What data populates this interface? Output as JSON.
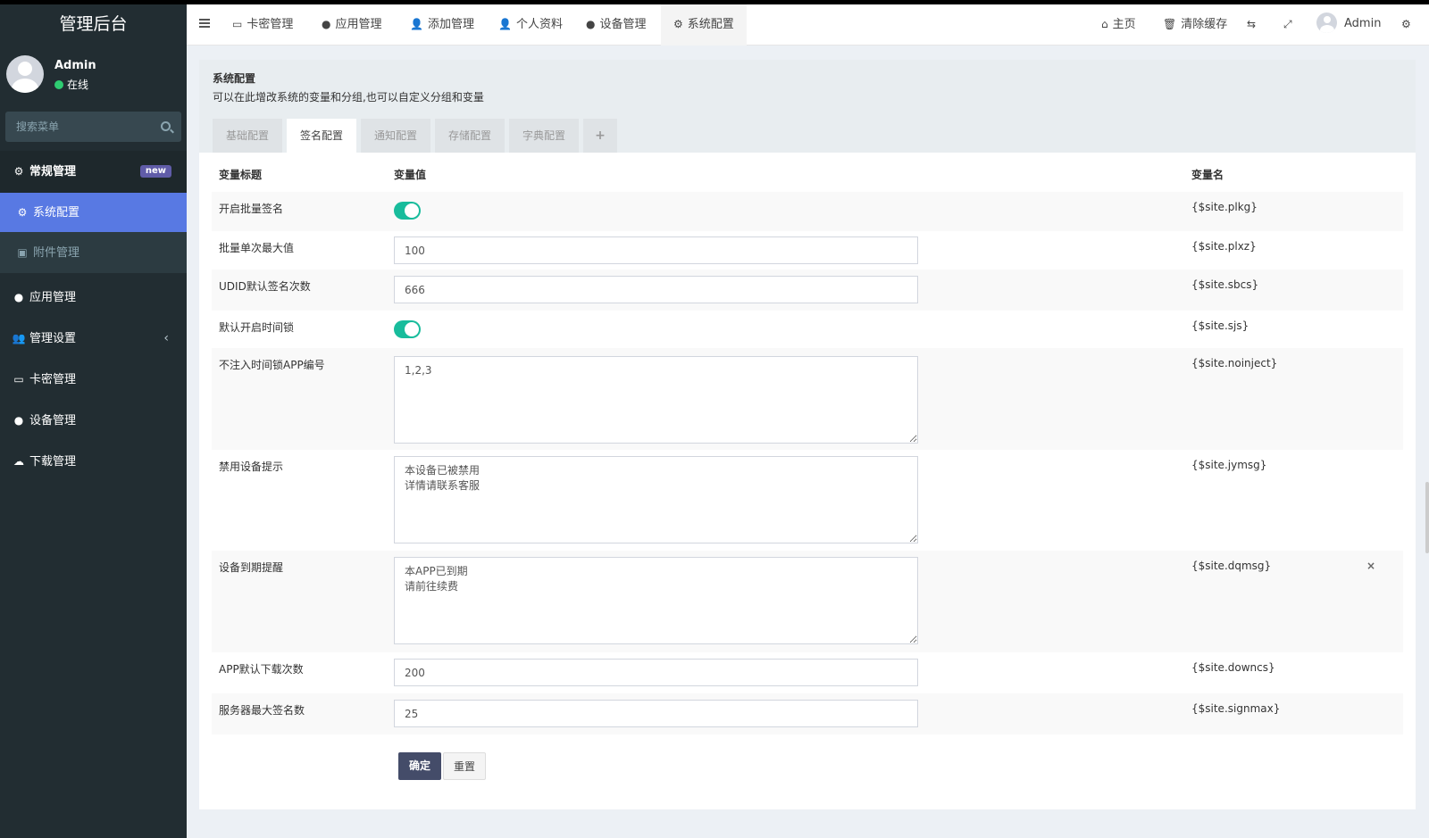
{
  "app": {
    "title": "管理后台"
  },
  "user": {
    "name": "Admin",
    "status": "在线"
  },
  "sidebar": {
    "search_placeholder": "搜索菜单",
    "header": {
      "label": "常规管理",
      "badge": "new"
    },
    "items": [
      {
        "label": "系统配置",
        "icon": "gear-icon",
        "active": true
      },
      {
        "label": "附件管理",
        "icon": "image-icon"
      },
      {
        "label": "应用管理",
        "icon": "circle-icon"
      },
      {
        "label": "管理设置",
        "icon": "users-icon",
        "has_children": true
      },
      {
        "label": "卡密管理",
        "icon": "credit-card-icon"
      },
      {
        "label": "设备管理",
        "icon": "apple-icon"
      },
      {
        "label": "下载管理",
        "icon": "cloud-download-icon"
      }
    ]
  },
  "topnav": {
    "tabs": [
      {
        "label": "卡密管理",
        "icon": "credit-card-icon"
      },
      {
        "label": "应用管理",
        "icon": "circle-icon"
      },
      {
        "label": "添加管理",
        "icon": "user-icon"
      },
      {
        "label": "个人资料",
        "icon": "user-icon"
      },
      {
        "label": "设备管理",
        "icon": "apple-icon"
      },
      {
        "label": "系统配置",
        "icon": "gear-icon",
        "active": true
      }
    ],
    "home": "主页",
    "clear_cache": "清除缓存",
    "username": "Admin"
  },
  "panel": {
    "title": "系统配置",
    "description": "可以在此增改系统的变量和分组,也可以自定义分组和变量",
    "tabs": [
      "基础配置",
      "签名配置",
      "通知配置",
      "存储配置",
      "字典配置",
      "+"
    ],
    "active_tab": "签名配置",
    "columns": {
      "title": "变量标题",
      "value": "变量值",
      "name": "变量名"
    },
    "rows": [
      {
        "label": "开启批量签名",
        "type": "switch",
        "value": true,
        "varname": "{$site.plkg}"
      },
      {
        "label": "批量单次最大值",
        "type": "text",
        "value": "100",
        "varname": "{$site.plxz}"
      },
      {
        "label": "UDID默认签名次数",
        "type": "text",
        "value": "666",
        "varname": "{$site.sbcs}"
      },
      {
        "label": "默认开启时间锁",
        "type": "switch",
        "value": true,
        "varname": "{$site.sjs}"
      },
      {
        "label": "不注入时间锁APP编号",
        "type": "textarea",
        "value": "1,2,3",
        "varname": "{$site.noinject}"
      },
      {
        "label": "禁用设备提示",
        "type": "textarea",
        "value": "本设备已被禁用\n详情请联系客服",
        "varname": "{$site.jymsg}"
      },
      {
        "label": "设备到期提醒",
        "type": "textarea",
        "value": "本APP已到期\n请前往续费",
        "varname": "{$site.dqmsg}"
      },
      {
        "label": "APP默认下载次数",
        "type": "text",
        "value": "200",
        "varname": "{$site.downcs}"
      },
      {
        "label": "服务器最大签名数",
        "type": "text",
        "value": "25",
        "varname": "{$site.signmax}"
      }
    ],
    "remove_label": "×",
    "submit": "确定",
    "reset": "重置"
  }
}
